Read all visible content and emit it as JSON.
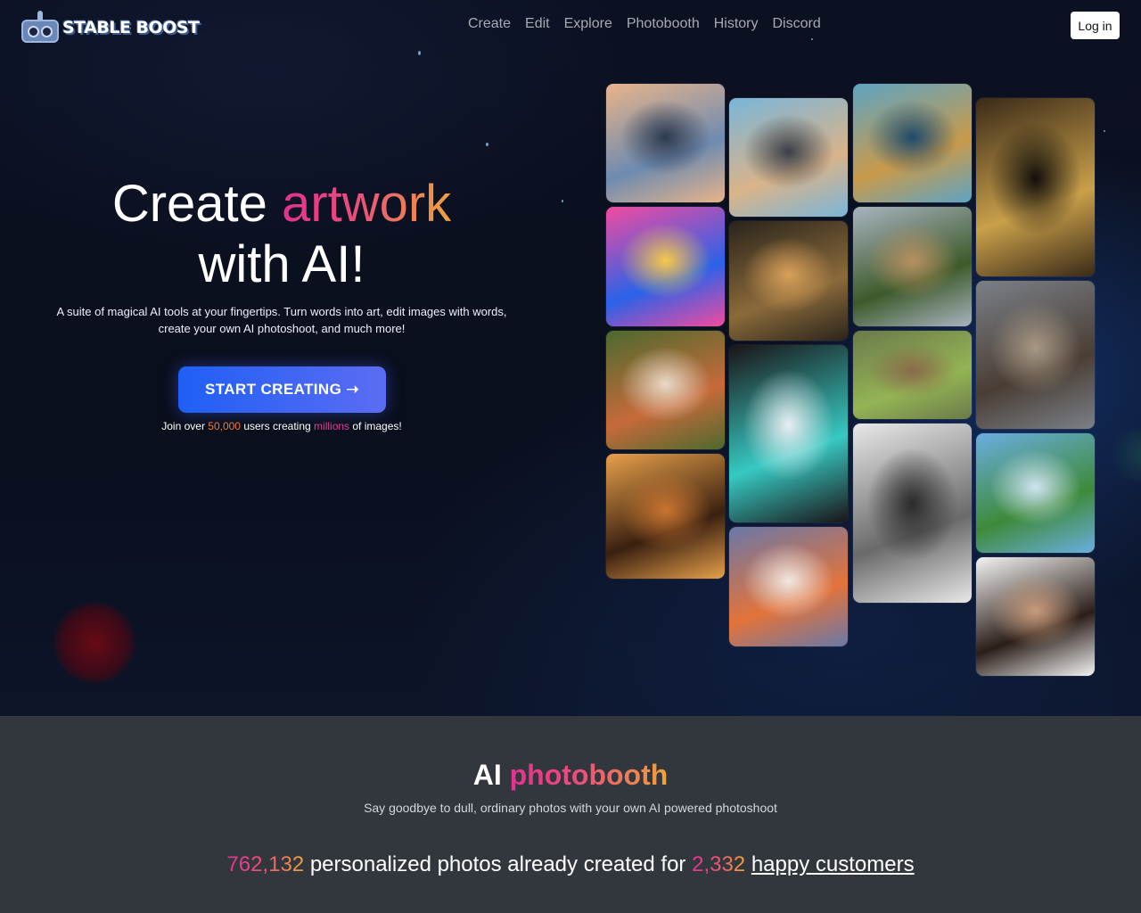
{
  "header": {
    "logo_text": "STABLE BOOST",
    "nav": [
      "Create",
      "Edit",
      "Explore",
      "Photobooth",
      "History",
      "Discord"
    ],
    "login_label": "Log in"
  },
  "hero": {
    "title_part1": "Create ",
    "title_highlight": "artwork",
    "title_part2": "with AI!",
    "subtitle": "A suite of magical AI tools at your fingertips. Turn words into art, edit images with words, create your own AI photoshoot, and much more!",
    "cta_label": "START CREATING ➝",
    "join_prefix": "Join over ",
    "join_users": "50,000",
    "join_mid": " users creating ",
    "join_millions": "millions",
    "join_suffix": " of images!"
  },
  "gallery": [
    {
      "name": "tile-street-cars",
      "colors": [
        "#e8b48a",
        "#6e8bb0",
        "#2d3a4f"
      ]
    },
    {
      "name": "tile-black-dog",
      "colors": [
        "#f24ba0",
        "#2a62e8",
        "#f7c94a"
      ]
    },
    {
      "name": "tile-redhead-woman",
      "colors": [
        "#4c6a2e",
        "#c76a3a",
        "#e9dac8"
      ]
    },
    {
      "name": "tile-african-queen",
      "colors": [
        "#e7a04a",
        "#3a2010",
        "#c8742f"
      ]
    },
    {
      "name": "tile-robot-boy",
      "colors": [
        "#7ab5d9",
        "#d9b48a",
        "#3b3f48"
      ]
    },
    {
      "name": "tile-castle",
      "colors": [
        "#2a241c",
        "#8a6a3a",
        "#d9a05a"
      ]
    },
    {
      "name": "tile-anime-girl",
      "colors": [
        "#1a1416",
        "#37c9c2",
        "#e9eef2"
      ]
    },
    {
      "name": "tile-fox",
      "colors": [
        "#6a78a8",
        "#e3733a",
        "#f0e8e2"
      ]
    },
    {
      "name": "tile-winged-dog",
      "colors": [
        "#5da4c4",
        "#c99a4a",
        "#1e4a6a"
      ]
    },
    {
      "name": "tile-forest-road",
      "colors": [
        "#a8b4c0",
        "#3e5a2a",
        "#b89060"
      ]
    },
    {
      "name": "tile-green-car",
      "colors": [
        "#6a7a4a",
        "#94b454",
        "#8a6a4a"
      ]
    },
    {
      "name": "tile-armored-warrior",
      "colors": [
        "#e8e8e8",
        "#6a6a6a",
        "#2a2a2a"
      ]
    },
    {
      "name": "tile-afro-man",
      "colors": [
        "#3a2a18",
        "#c9a04a",
        "#12100c"
      ]
    },
    {
      "name": "tile-ruined-capitol",
      "colors": [
        "#7a8088",
        "#4a3e34",
        "#a89884"
      ]
    },
    {
      "name": "tile-fantasy-landscape",
      "colors": [
        "#6aaee0",
        "#3e8a3a",
        "#d0e4f0"
      ]
    },
    {
      "name": "tile-smiling-woman",
      "colors": [
        "#f4f4f4",
        "#2a1e18",
        "#c99a7a"
      ]
    }
  ],
  "photobooth": {
    "title_part1": "AI ",
    "title_highlight": "photobooth",
    "subtitle": "Say goodbye to dull, ordinary photos with your own AI powered photoshoot",
    "photos_count": "762,132",
    "stats_mid": " personalized photos already created for ",
    "customers_count": "2,332",
    "stats_link": "happy customers"
  }
}
